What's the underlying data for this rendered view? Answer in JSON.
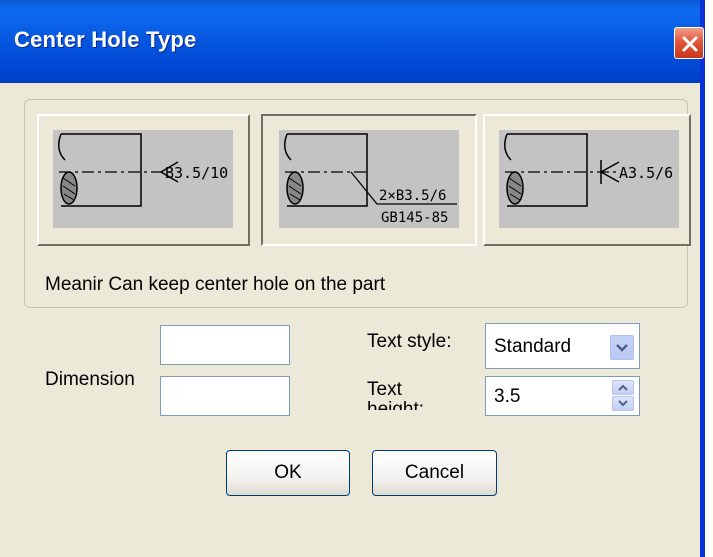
{
  "window": {
    "title": "Center Hole Type",
    "close_icon": "close-icon"
  },
  "type_buttons": [
    {
      "label": "B3.5/10",
      "selected": false
    },
    {
      "label_top": "2×B3.5/6",
      "label_bottom": "GB145-85",
      "selected": true
    },
    {
      "label": "A3.5/6",
      "selected": false
    }
  ],
  "meaning": {
    "text": "Meanir Can keep center hole on the part"
  },
  "form": {
    "dimension_label": "Dimension",
    "dimension_value_1": "",
    "dimension_value_2": "",
    "text_style_label": "Text style:",
    "text_style_value": "Standard",
    "text_height_label_line1": "Text",
    "text_height_label_line2": "height:",
    "text_height_value": "3.5"
  },
  "buttons": {
    "ok": "OK",
    "cancel": "Cancel"
  },
  "colors": {
    "titlebar": "#0758e0",
    "dialog_bg": "#ece9d8",
    "close": "#e2563a"
  }
}
